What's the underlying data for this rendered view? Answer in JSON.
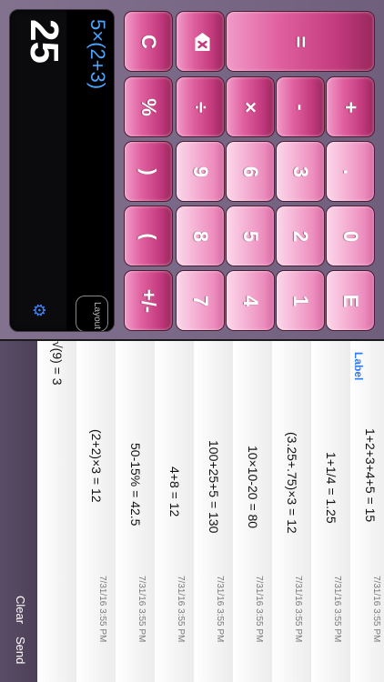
{
  "display": {
    "result": "25",
    "expression": "5×(2+3)",
    "layout_label": "Layout",
    "gear_icon": "gear-icon",
    "page_dots": "○○●"
  },
  "keys": [
    {
      "name": "clear-key",
      "label": "C",
      "kind": "op"
    },
    {
      "name": "backspace-key",
      "label": "",
      "kind": "op",
      "icon": "backspace-icon"
    },
    {
      "name": "equals-key",
      "label": "=",
      "kind": "op"
    },
    {
      "name": "percent-key",
      "label": "%",
      "kind": "op"
    },
    {
      "name": "divide-key",
      "label": "÷",
      "kind": "op"
    },
    {
      "name": "multiply-key",
      "label": "×",
      "kind": "op"
    },
    {
      "name": "subtract-key",
      "label": "-",
      "kind": "op"
    },
    {
      "name": "add-key",
      "label": "+",
      "kind": "op"
    },
    {
      "name": "close-paren-key",
      "label": ")",
      "kind": "op"
    },
    {
      "name": "digit-9-key",
      "label": "9",
      "kind": "num"
    },
    {
      "name": "digit-6-key",
      "label": "6",
      "kind": "num"
    },
    {
      "name": "digit-3-key",
      "label": "3",
      "kind": "num"
    },
    {
      "name": "decimal-key",
      "label": ".",
      "kind": "num"
    },
    {
      "name": "open-paren-key",
      "label": "(",
      "kind": "op"
    },
    {
      "name": "digit-8-key",
      "label": "8",
      "kind": "num"
    },
    {
      "name": "digit-5-key",
      "label": "5",
      "kind": "num"
    },
    {
      "name": "digit-2-key",
      "label": "2",
      "kind": "num"
    },
    {
      "name": "digit-0-key",
      "label": "0",
      "kind": "num"
    },
    {
      "name": "sign-key",
      "label": "+/-",
      "kind": "op"
    },
    {
      "name": "digit-7-key",
      "label": "7",
      "kind": "num"
    },
    {
      "name": "digit-4-key",
      "label": "4",
      "kind": "num"
    },
    {
      "name": "digit-1-key",
      "label": "1",
      "kind": "num"
    },
    {
      "name": "exponent-key",
      "label": "E",
      "kind": "num"
    }
  ],
  "toolbar": {
    "clear_label": "Clear",
    "send_label": "Send"
  },
  "history": [
    {
      "equation": "√(9) = 3",
      "timestamp": ""
    },
    {
      "equation": "(2+2)×3 = 12",
      "timestamp": "7/31/16 3:55 PM"
    },
    {
      "equation": "50-15% = 42.5",
      "timestamp": "7/31/16 3:55 PM"
    },
    {
      "equation": "4+8 = 12",
      "timestamp": "7/31/16 3:55 PM"
    },
    {
      "equation": "100+25+5 = 130",
      "timestamp": "7/31/16 3:55 PM"
    },
    {
      "equation": "10×10-20 = 80",
      "timestamp": "7/31/16 3:55 PM"
    },
    {
      "equation": "(3.25+.75)×3 = 12",
      "timestamp": "7/31/16 3:55 PM"
    },
    {
      "equation": "1+1/4 = 1.25",
      "timestamp": "7/31/16 3:55 PM"
    },
    {
      "equation": "1+2+3+4+5 = 15",
      "timestamp": "7/31/16 3:55 PM",
      "label": "Label"
    }
  ]
}
